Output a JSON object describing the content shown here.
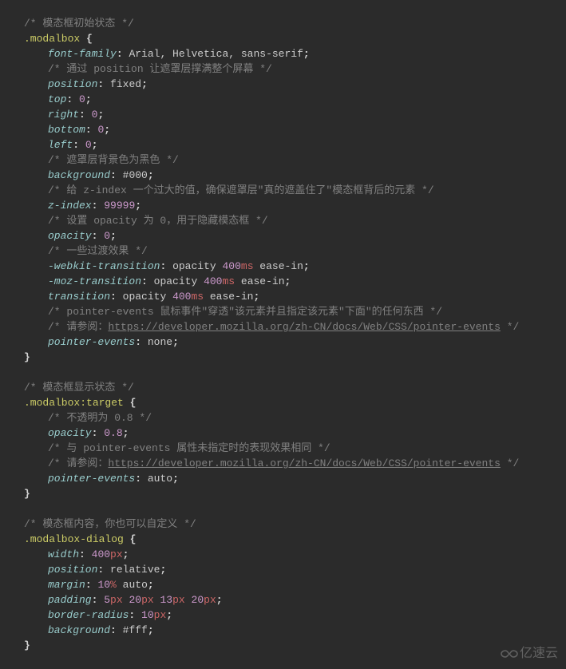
{
  "code": {
    "comment_initial": "/* 模态框初始状态 */",
    "selector_modalbox": ".modalbox",
    "brace_open": "{",
    "brace_close": "}",
    "font_family_prop": "font-family",
    "font_family_val": "Arial, Helvetica, sans-serif",
    "comment_position": "/* 通过 position 让遮罩层撑满整个屏幕 */",
    "position_prop": "position",
    "position_val_fixed": "fixed",
    "top_prop": "top",
    "zero": "0",
    "right_prop": "right",
    "bottom_prop": "bottom",
    "left_prop": "left",
    "comment_bg": "/* 遮罩层背景色为黑色 */",
    "background_prop": "background",
    "background_val_black": "#000",
    "comment_zindex": "/* 给 z-index 一个过大的值，确保遮罩层\"真的遮盖住了\"模态框背后的元素 */",
    "zindex_prop": "z-index",
    "zindex_val": "99999",
    "comment_opacity": "/* 设置 opacity 为 0，用于隐藏模态框 */",
    "opacity_prop": "opacity",
    "comment_transition": "/* 一些过渡效果 */",
    "webkit_transition_prop": "-webkit-transition",
    "moz_transition_prop": "-moz-transition",
    "transition_prop": "transition",
    "transition_val_part1": "opacity ",
    "transition_val_num": "400",
    "transition_val_unit": "ms",
    "transition_val_part2": " ease-in",
    "comment_pointer1": "/* pointer-events 鼠标事件\"穿透\"该元素并且指定该元素\"下面\"的任何东西 */",
    "comment_ref_prefix": "/* 请参阅：",
    "url_pointer_events": "https://developer.mozilla.org/zh-CN/docs/Web/CSS/pointer-events",
    "comment_ref_suffix": " */",
    "pointer_events_prop": "pointer-events",
    "pointer_events_none": "none",
    "comment_display": "/* 模态框显示状态 */",
    "selector_target": ".modalbox:target",
    "comment_opacity08": "/* 不透明为 0.8 */",
    "opacity_08": "0.8",
    "comment_pointer2": "/* 与 pointer-events 属性未指定时的表现效果相同 */",
    "pointer_events_auto": "auto",
    "comment_dialog": "/* 模态框内容，你也可以自定义 */",
    "selector_dialog": ".modalbox-dialog",
    "width_prop": "width",
    "width_num": "400",
    "px": "px",
    "position_val_relative": "relative",
    "margin_prop": "margin",
    "margin_num": "10",
    "percent": "%",
    "margin_auto": " auto",
    "padding_prop": "padding",
    "pad_5": "5",
    "pad_20": "20",
    "pad_13": "13",
    "border_radius_prop": "border-radius",
    "border_radius_num": "10",
    "background_val_white": "#fff",
    "colon": ":",
    "semi": ";",
    "space": " "
  },
  "watermark": {
    "text": "亿速云"
  }
}
